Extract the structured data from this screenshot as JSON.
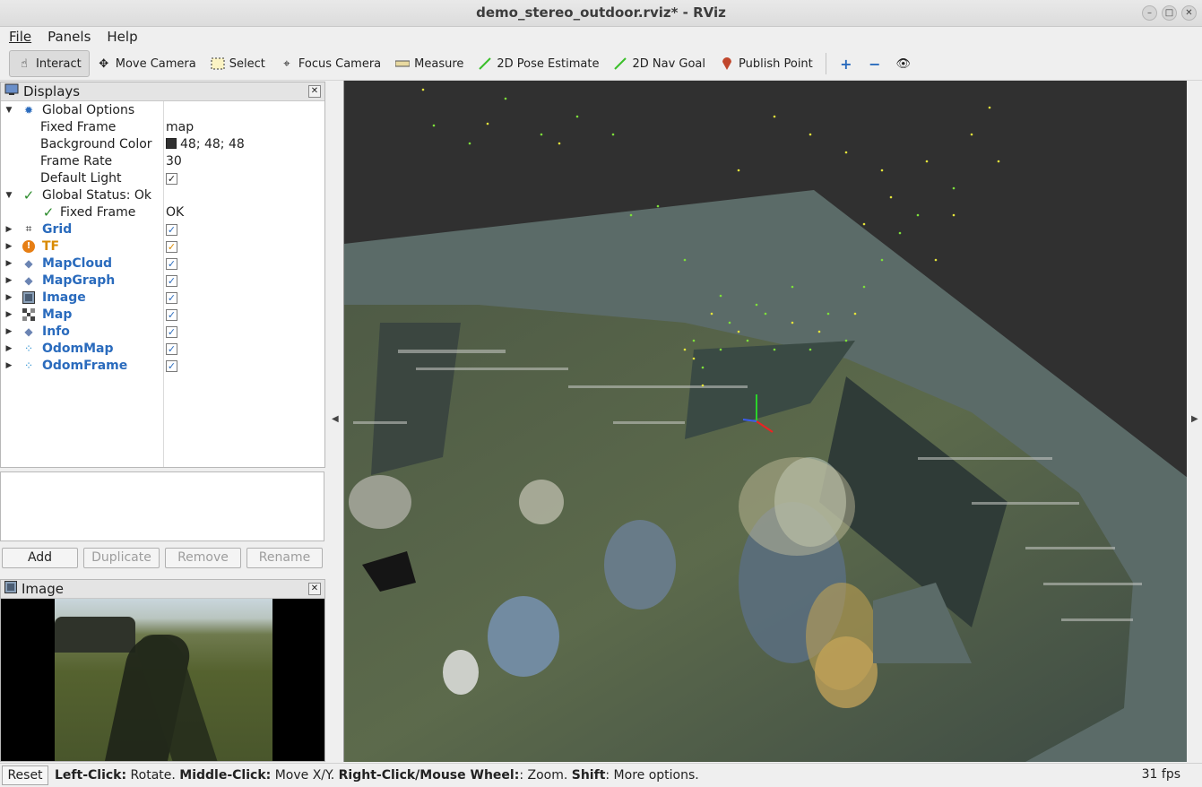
{
  "window": {
    "title": "demo_stereo_outdoor.rviz* - RViz"
  },
  "menu": {
    "file": "File",
    "panels": "Panels",
    "help": "Help"
  },
  "toolbar": {
    "interact": "Interact",
    "move_camera": "Move Camera",
    "select": "Select",
    "focus_camera": "Focus Camera",
    "measure": "Measure",
    "pose_estimate": "2D Pose Estimate",
    "nav_goal": "2D Nav Goal",
    "publish_point": "Publish Point"
  },
  "displays": {
    "title": "Displays",
    "global_options": "Global Options",
    "fixed_frame_label": "Fixed Frame",
    "fixed_frame_value": "map",
    "bg_color_label": "Background Color",
    "bg_color_value": "48; 48; 48",
    "frame_rate_label": "Frame Rate",
    "frame_rate_value": "30",
    "default_light_label": "Default Light",
    "global_status": "Global Status: Ok",
    "status_fixed_frame_label": "Fixed Frame",
    "status_fixed_frame_value": "OK",
    "items": [
      "Grid",
      "TF",
      "MapCloud",
      "MapGraph",
      "Image",
      "Map",
      "Info",
      "OdomMap",
      "OdomFrame"
    ]
  },
  "buttons": {
    "add": "Add",
    "duplicate": "Duplicate",
    "remove": "Remove",
    "rename": "Rename"
  },
  "image_panel": {
    "title": "Image"
  },
  "status": {
    "reset": "Reset",
    "left_click": "Left-Click:",
    "left_click_desc": " Rotate. ",
    "middle_click": "Middle-Click:",
    "middle_click_desc": " Move X/Y. ",
    "right_click": "Right-Click/Mouse Wheel:",
    "right_click_desc": ": Zoom. ",
    "shift": "Shift",
    "shift_desc": ": More options.",
    "fps": "31 fps"
  },
  "colors": {
    "background": "#303030",
    "accent": "#2a6bbd",
    "tf_orange": "#d98a00",
    "point_green": "#7de03a"
  }
}
